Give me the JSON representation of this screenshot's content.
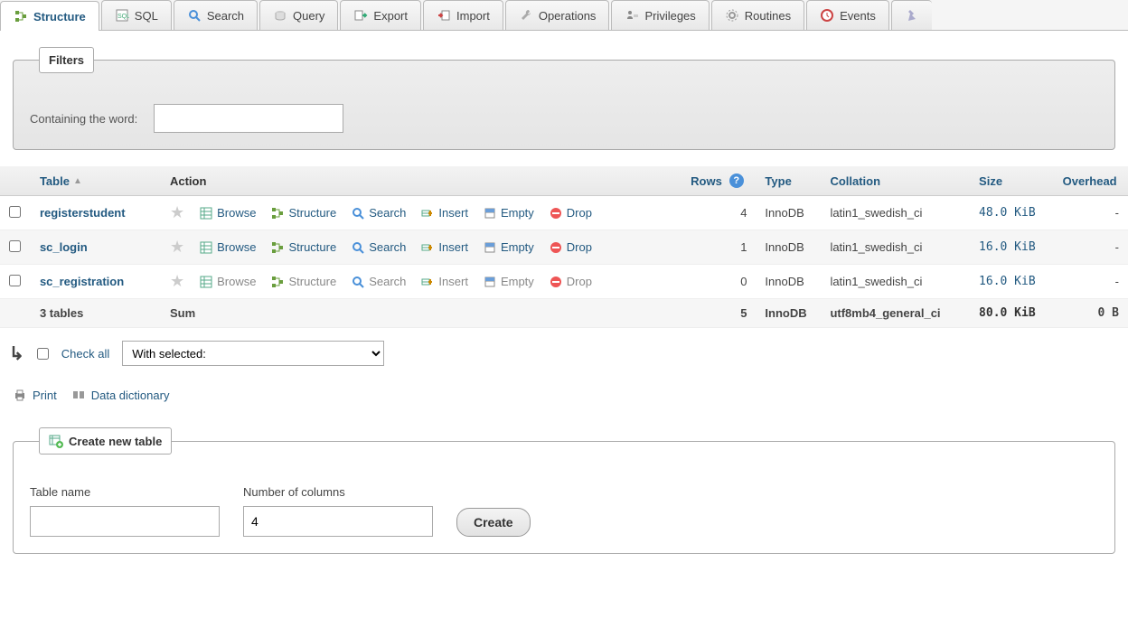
{
  "tabs": [
    {
      "label": "Structure",
      "active": true
    },
    {
      "label": "SQL"
    },
    {
      "label": "Search"
    },
    {
      "label": "Query"
    },
    {
      "label": "Export"
    },
    {
      "label": "Import"
    },
    {
      "label": "Operations"
    },
    {
      "label": "Privileges"
    },
    {
      "label": "Routines"
    },
    {
      "label": "Events"
    }
  ],
  "filters": {
    "legend": "Filters",
    "label": "Containing the word:"
  },
  "columns": {
    "table": "Table",
    "action": "Action",
    "rows": "Rows",
    "type": "Type",
    "collation": "Collation",
    "size": "Size",
    "overhead": "Overhead"
  },
  "actions": {
    "browse": "Browse",
    "structure": "Structure",
    "search": "Search",
    "insert": "Insert",
    "empty": "Empty",
    "drop": "Drop"
  },
  "rows": [
    {
      "name": "registerstudent",
      "rows": "4",
      "type": "InnoDB",
      "collation": "latin1_swedish_ci",
      "size": "48.0 KiB",
      "overhead": "-",
      "muted": false
    },
    {
      "name": "sc_login",
      "rows": "1",
      "type": "InnoDB",
      "collation": "latin1_swedish_ci",
      "size": "16.0 KiB",
      "overhead": "-",
      "muted": false
    },
    {
      "name": "sc_registration",
      "rows": "0",
      "type": "InnoDB",
      "collation": "latin1_swedish_ci",
      "size": "16.0 KiB",
      "overhead": "-",
      "muted": true
    }
  ],
  "summary": {
    "count_label": "3 tables",
    "sum_label": "Sum",
    "rows": "5",
    "type": "InnoDB",
    "collation": "utf8mb4_general_ci",
    "size": "80.0 KiB",
    "overhead": "0 B"
  },
  "checkall": {
    "label": "Check all",
    "selected": "With selected:"
  },
  "links": {
    "print": "Print",
    "dict": "Data dictionary"
  },
  "create": {
    "legend": "Create new table",
    "name_label": "Table name",
    "cols_label": "Number of columns",
    "cols_value": "4",
    "button": "Create"
  }
}
